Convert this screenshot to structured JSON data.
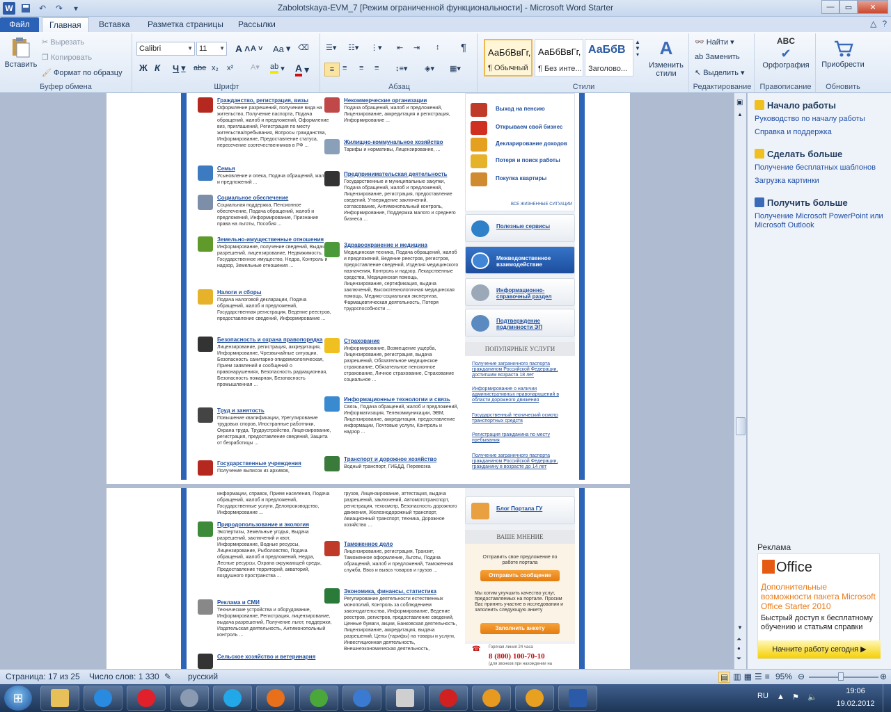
{
  "window": {
    "title": "Zabolotskaya-EVM_7 [Режим ограниченной функциональности]  -  Microsoft Word Starter",
    "app_icon": "W"
  },
  "tabs": {
    "file": "Файл",
    "home": "Главная",
    "insert": "Вставка",
    "layout": "Разметка страницы",
    "mailings": "Рассылки"
  },
  "clipboard": {
    "paste": "Вставить",
    "cut": "Вырезать",
    "copy": "Копировать",
    "format_painter": "Формат по образцу",
    "label": "Буфер обмена"
  },
  "font": {
    "name": "Calibri",
    "size": "11",
    "label": "Шрифт",
    "bold": "Ж",
    "italic": "К",
    "underline": "Ч",
    "strike": "abe",
    "sub": "x₂",
    "sup": "x²",
    "grow": "A",
    "shrink": "A",
    "case": "Aa"
  },
  "paragraph": {
    "label": "Абзац"
  },
  "styles": {
    "label": "Стили",
    "items": [
      {
        "preview": "АаБбВвГг,",
        "name": "¶ Обычный"
      },
      {
        "preview": "АаБбВвГг,",
        "name": "¶ Без инте..."
      },
      {
        "preview": "АаБбВ",
        "name": "Заголово..."
      }
    ],
    "change": "Изменить стили"
  },
  "editing": {
    "label": "Редактирование",
    "find": "Найти",
    "replace": "Заменить",
    "select": "Выделить"
  },
  "proofing": {
    "label": "Правописание",
    "spelling": "Орфография",
    "abc": "ABC"
  },
  "upgrade": {
    "label": "Обновить",
    "purchase": "Приобрести"
  },
  "portal": {
    "left": [
      {
        "h": "Гражданство, регистрация, визы",
        "d": "Оформление разрешений, получение вида на жительство, Получение паспорта, Подача обращений, жалоб и предложений, Оформление виз, приглашений, Регистрация по месту жительства/пребывания, Вопросы гражданства, Информирование, Предоставление статуса, пересечение соотечественников в РФ ...",
        "c": "#b5281f"
      },
      {
        "h": "Семья",
        "d": "Усыновление и опека, Подача обращений, жалоб и предложений ...",
        "c": "#3d7bc0"
      },
      {
        "h": "Социальное обеспечение",
        "d": "Социальная поддержка, Пенсионное обеспечение, Подача обращений, жалоб и предложений, Информирование, Признание права на льготы, Пособия ...",
        "c": "#7d8fa8"
      },
      {
        "h": "Земельно-имущественные отношения",
        "d": "Информирование, получение сведений, Выдача разрешений, лицензирование, Недвижимость, Государственное имущество, Недра, Контроль и надзор, Земельные отношения ...",
        "c": "#5f9a2a"
      },
      {
        "h": "Налоги и сборы",
        "d": "Подача налоговой декларации, Подача обращений, жалоб и предложений, Государственная регистрация, Ведение реестров, предоставление сведений, Информирование ...",
        "c": "#e5b22a"
      },
      {
        "h": "Безопасность и охрана правопорядка",
        "d": "Лицензирование, регистрация, аккредитация, Информирование, Чрезвычайные ситуации, Безопасность санитарно-эпидемиологическая, Прием заявлений и сообщений о правонарушениях, Безопасность радиационная, Безопасность пожарная, Безопасность промышленная ...",
        "c": "#333333"
      },
      {
        "h": "Труд и занятость",
        "d": "Повышение квалификации, Урегулирование трудовых споров, Иностранные работники, Охрана труда, Трудоустройство, Лицензирование, регистрация, предоставление сведений, Защита от безработицы ...",
        "c": "#444444"
      },
      {
        "h": "Государственные учреждения",
        "d": "Получение выписок из архивов,",
        "c": "#b5281f"
      }
    ],
    "middle": [
      {
        "h": "Некоммерческие организации",
        "d": "Подача обращений, жалоб и предложений, Лицензирование, аккредитация и регистрация, Информирование ...",
        "c": "#c04848"
      },
      {
        "h": "Жилищно-коммунальное хозяйство",
        "d": "Тарифы и нормативы, Лицензирование, ...",
        "c": "#8aa0b8"
      },
      {
        "h": "Предпринимательская деятельность",
        "d": "Государственные и муниципальные закупки, Подача обращений, жалоб и предложений, Лицензирование, регистрация, предоставление сведений, Утверждение заключений, согласование, Антимонопольный контроль, Информирование, Поддержка малого и среднего бизнеса ...",
        "c": "#333333"
      },
      {
        "h": "Здравоохранение и медицина",
        "d": "Медицинская техника, Подача обращений, жалоб и предложений, Ведение реестров, регистров, предоставление сведений, Изделия медицинского назначения, Контроль и надзор, Лекарственные средства, Медицинская помощь, Лицензирование, сертификация, выдача заключений, Высокотехнологичная медицинская помощь, Медико-социальная экспертиза, Фармацевтическая деятельность, Потеря трудоспособности ...",
        "c": "#4a9a3a"
      },
      {
        "h": "Страхование",
        "d": "Информирование, Возмещение ущерба, Лицензирование, регистрация, выдача разрешений, Обязательное медицинское страхование, Обязательное пенсионное страхование, Личное страхование, Страхование социальное ...",
        "c": "#f0c020"
      },
      {
        "h": "Информационные технологии и связь",
        "d": "Связь, Подача обращений, жалоб и предложений, Информатизация, Телекоммуникации, ЭВМ, Лицензирование, аккредитация, предоставление информации, Почтовые услуги, Контроль и надзор ...",
        "c": "#3a8ad0"
      },
      {
        "h": "Транспорт и дорожное хозяйство",
        "d": "Водный транспорт, ГИБДД, Перевозка",
        "c": "#3a7a3a"
      }
    ],
    "left2": [
      {
        "h": "",
        "d": "информации, справок, Прием населения, Подача обращений, жалоб и предложений, Государственные услуги, Делопроизводство, Информирование ...",
        "c": ""
      },
      {
        "h": "Природопользование и экология",
        "d": "Экспертизы, Земельные угодья, Выдача разрешений, заключений и квот, Информирование, Водные ресурсы, Лицензирование, Рыболовство, Подача обращений, жалоб и предложений, Недра, Лесные ресурсы, Охрана окружающей среды, Предоставление территорий, акваторий, воздушного пространства ...",
        "c": "#3d8a3a"
      },
      {
        "h": "Реклама и СМИ",
        "d": "Технические устройства и оборудование, Информирование, Регистрация, лицензирование, выдача разрешений, Получение льгот, поддержки, Издательская деятельность, Антимонопольный контроль ...",
        "c": "#888888"
      },
      {
        "h": "Сельское хозяйство и ветеринария",
        "d": "",
        "c": "#333333"
      }
    ],
    "middle2": [
      {
        "h": "",
        "d": "грузов, Лицензирование, аттестация, выдача разрешений, заключений, Автомототранспорт, регистрация, техосмотр, Безопасность дорожного движения, Железнодорожный транспорт, Авиационный транспорт, техника, Дорожное хозяйство ...",
        "c": ""
      },
      {
        "h": "Таможенное дело",
        "d": "Лицензирование, регистрация, Транзит, Таможенное оформление, Льготы, Подача обращений, жалоб и предложений, Таможенная служба, Ввоз и вывоз товаров и грузов ...",
        "c": "#c03a2a"
      },
      {
        "h": "Экономика, финансы, статистика",
        "d": "Регулирование деятельности естественных монополий, Контроль за соблюдением законодательства, Информирование, Ведение реестров, регистров, предоставление сведений, Ценные бумаги, акции, Банковская деятельность, Лицензирование, аккредитация, выдача разрешений, Цены (тарифы) на товары и услуги, Инвестиционная деятельность, Внешнеэкономическая деятельность,",
        "c": "#2a7a3a"
      }
    ],
    "life": [
      {
        "t": "Выход на пенсию",
        "c": "#c03a2a"
      },
      {
        "t": "Открываем свой бизнес",
        "c": "#d03020"
      },
      {
        "t": "Декларирование доходов",
        "c": "#e5a020"
      },
      {
        "t": "Потеря и поиск работы",
        "c": "#e5b22a"
      },
      {
        "t": "Покупка квартиры",
        "c": "#d08a30"
      }
    ],
    "all_life": "ВСЕ ЖИЗНЕННЫЕ СИТУАЦИИ",
    "services": [
      {
        "t": "Полезные сервисы",
        "c": "#2e80c8",
        "active": false
      },
      {
        "t": "Межведомственное взаимодействие",
        "c": "#ffffff",
        "active": true
      },
      {
        "t": "Информационно-справочный раздел",
        "c": "#9aa8b8",
        "active": false
      },
      {
        "t": "Подтверждение подлинности ЭП",
        "c": "#5a8ac0",
        "active": false
      }
    ],
    "popular_head": "ПОПУЛЯРНЫЕ УСЛУГИ",
    "popular": [
      "Получение заграничного паспорта гражданином Российской Федерации, достигшим возраста 18 лет",
      "Информирование о наличии административных правонарушений в области дорожного движения",
      "Государственный технический осмотр транспортных средств",
      "Регистрация гражданина по месту пребывания",
      "Получение заграничного паспорта гражданином Российской Федерации, гражданину в возрасте до 14 лет"
    ],
    "blog": "Блог Портала ГУ",
    "opinion_head": "ВАШЕ МНЕНИЕ",
    "opinion_text": "Отправить свое предложение по работе портала",
    "send_btn": "Отправить сообщение",
    "survey_text": "Мы хотим улучшить качество услуг, предоставляемых на портале. Просим Вас принять участие в исследовании и заполнить следующую анкету",
    "survey_btn": "Заполнить анкету",
    "hotline_label": "Горячая линия 24 часа",
    "hotline": "8 (800) 100-70-10",
    "hotline_note": "(для звонков при нахождении на"
  },
  "taskpane": {
    "h1": "Начало работы",
    "l1": "Руководство по началу работы",
    "l2": "Справка и поддержка",
    "h2": "Сделать больше",
    "l3": "Получение бесплатных шаблонов",
    "l4": "Загрузка картинки",
    "h3": "Получить больше",
    "l5": "Получение Microsoft PowerPoint или Microsoft Outlook",
    "ad_label": "Реклама",
    "ad_logo": "Office",
    "ad_title": "Дополнительные возможности пакета Microsoft Office Starter 2010",
    "ad_text": "Быстрый доступ к бесплатному обучению и статьям справки",
    "ad_btn": "Начните работу сегодня ▶"
  },
  "status": {
    "page": "Страница: 17 из 25",
    "words": "Число слов: 1 330",
    "lang": "русский",
    "zoom": "95%"
  },
  "tray": {
    "lang": "RU",
    "time": "19:06",
    "date": "19.02.2012"
  },
  "taskbar": [
    {
      "name": "explorer",
      "c": "#e8c05a"
    },
    {
      "name": "ie",
      "c": "#2a8ae0"
    },
    {
      "name": "opera",
      "c": "#e0202a"
    },
    {
      "name": "camera",
      "c": "#8a9ab0"
    },
    {
      "name": "skype",
      "c": "#22a8e8"
    },
    {
      "name": "firefox",
      "c": "#e8701a"
    },
    {
      "name": "utorrent",
      "c": "#4aa83a"
    },
    {
      "name": "music",
      "c": "#3a7ad0"
    },
    {
      "name": "microsoft",
      "c": "#cfcfcf"
    },
    {
      "name": "game",
      "c": "#d02020"
    },
    {
      "name": "disc",
      "c": "#e89a20"
    },
    {
      "name": "half-life",
      "c": "#e8a020"
    },
    {
      "name": "word",
      "c": "#2a5aa8"
    }
  ]
}
